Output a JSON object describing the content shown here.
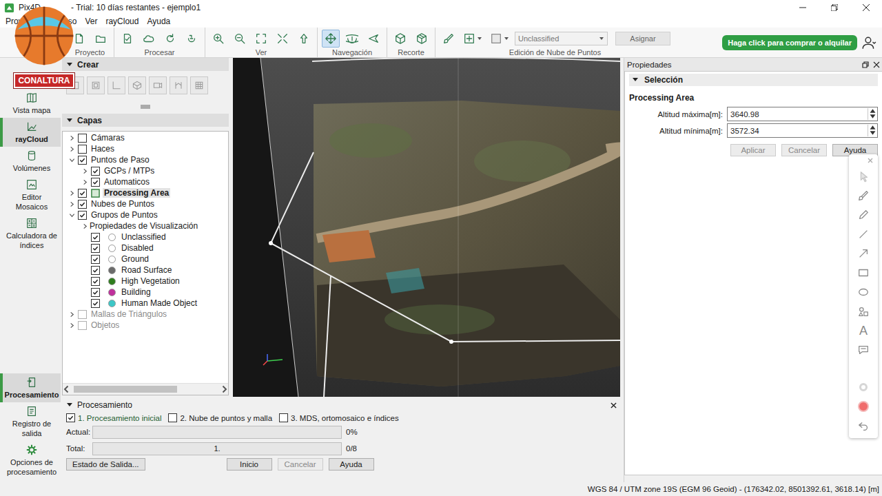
{
  "window": {
    "title_app": "Pix4D",
    "title_rest": "- Trial: 10 días restantes - ejemplo1"
  },
  "watermark": "CONALTURA",
  "menu": [
    "Proyecto",
    "Proceso",
    "Ver",
    "rayCloud",
    "Ayuda"
  ],
  "toolbar": {
    "groups": [
      {
        "label": "Proyecto",
        "tools": [
          {
            "selected": false
          },
          {
            "selected": false
          }
        ]
      },
      {
        "label": "Procesar",
        "tools": [
          {
            "selected": false
          },
          {
            "selected": false
          },
          {
            "selected": false
          },
          {
            "selected": false
          }
        ]
      },
      {
        "label": "Ver",
        "tools": [
          {
            "selected": false
          },
          {
            "selected": false
          },
          {
            "selected": false
          },
          {
            "selected": false
          },
          {
            "selected": false
          }
        ]
      },
      {
        "label": "Navegación",
        "tools": [
          {
            "selected": true
          },
          {
            "selected": false
          },
          {
            "selected": false
          }
        ]
      },
      {
        "label": "Recorte",
        "tools": [
          {
            "selected": false
          },
          {
            "selected": false
          }
        ]
      }
    ],
    "edit": {
      "label": "Edición de Nube de Puntos",
      "class_select": "Unclassified",
      "assign": "Asignar"
    },
    "buy": "Haga click para comprar o alquilar"
  },
  "sidebar": {
    "top": [
      {
        "label": "Vista mapa",
        "selected": false
      },
      {
        "label": "rayCloud",
        "selected": true
      },
      {
        "label": "Volúmenes",
        "selected": false
      },
      {
        "label": "Editor Mosaicos",
        "selected": false
      },
      {
        "label": "Calculadora de índices",
        "selected": false
      }
    ],
    "bottom": [
      {
        "label": "Procesamiento",
        "selected": true
      },
      {
        "label": "Registro de salida",
        "selected": false
      },
      {
        "label": "Opciones de procesamiento",
        "selected": false
      }
    ]
  },
  "create": {
    "title": "Crear"
  },
  "layers": {
    "title": "Capas",
    "items": [
      {
        "label": "Cámaras",
        "kind": "layer",
        "depth": 0,
        "expandable": true,
        "expanded": false,
        "checked": false,
        "selected": false,
        "disabled": false,
        "color": ""
      },
      {
        "label": "Haces",
        "kind": "layer",
        "depth": 0,
        "expandable": true,
        "expanded": false,
        "checked": false,
        "selected": false,
        "disabled": false,
        "color": ""
      },
      {
        "label": "Puntos de Paso",
        "kind": "layer",
        "depth": 0,
        "expandable": true,
        "expanded": true,
        "checked": true,
        "selected": false,
        "disabled": false,
        "color": ""
      },
      {
        "label": "GCPs / MTPs",
        "kind": "layer",
        "depth": 1,
        "expandable": true,
        "expanded": false,
        "checked": true,
        "selected": false,
        "disabled": false,
        "color": ""
      },
      {
        "label": "Automaticos",
        "kind": "layer",
        "depth": 1,
        "expandable": true,
        "expanded": false,
        "checked": true,
        "selected": false,
        "disabled": false,
        "color": ""
      },
      {
        "label": "Processing Area",
        "kind": "area",
        "depth": 0,
        "expandable": true,
        "expanded": false,
        "checked": true,
        "selected": true,
        "disabled": false,
        "color": ""
      },
      {
        "label": "Nubes de Puntos",
        "kind": "layer",
        "depth": 0,
        "expandable": true,
        "expanded": false,
        "checked": true,
        "selected": false,
        "disabled": false,
        "color": ""
      },
      {
        "label": "Grupos de Puntos",
        "kind": "layer",
        "depth": 0,
        "expandable": true,
        "expanded": true,
        "checked": true,
        "selected": false,
        "disabled": false,
        "color": ""
      },
      {
        "label": "Propiedades de Visualización",
        "kind": "folder",
        "depth": 1,
        "expandable": true,
        "expanded": false,
        "checked": false,
        "selected": false,
        "disabled": false,
        "color": ""
      },
      {
        "label": "Unclassified",
        "kind": "class",
        "depth": 1,
        "expandable": false,
        "expanded": false,
        "checked": true,
        "selected": false,
        "disabled": false,
        "color": "#ffffff"
      },
      {
        "label": "Disabled",
        "kind": "class",
        "depth": 1,
        "expandable": false,
        "expanded": false,
        "checked": true,
        "selected": false,
        "disabled": false,
        "color": "#ffffff"
      },
      {
        "label": "Ground",
        "kind": "class",
        "depth": 1,
        "expandable": false,
        "expanded": false,
        "checked": true,
        "selected": false,
        "disabled": false,
        "color": "#ffffff"
      },
      {
        "label": "Road Surface",
        "kind": "class",
        "depth": 1,
        "expandable": false,
        "expanded": false,
        "checked": true,
        "selected": false,
        "disabled": false,
        "color": "#6b6b6b"
      },
      {
        "label": "High Vegetation",
        "kind": "class",
        "depth": 1,
        "expandable": false,
        "expanded": false,
        "checked": true,
        "selected": false,
        "disabled": false,
        "color": "#2f7d1e"
      },
      {
        "label": "Building",
        "kind": "class",
        "depth": 1,
        "expandable": false,
        "expanded": false,
        "checked": true,
        "selected": false,
        "disabled": false,
        "color": "#c0309c"
      },
      {
        "label": "Human Made Object",
        "kind": "class",
        "depth": 1,
        "expandable": false,
        "expanded": false,
        "checked": true,
        "selected": false,
        "disabled": false,
        "color": "#3cc7c7"
      },
      {
        "label": "Mallas de Triángulos",
        "kind": "layer",
        "depth": 0,
        "expandable": true,
        "expanded": false,
        "checked": false,
        "selected": false,
        "disabled": true,
        "color": ""
      },
      {
        "label": "Objetos",
        "kind": "layer",
        "depth": 0,
        "expandable": true,
        "expanded": false,
        "checked": false,
        "selected": false,
        "disabled": true,
        "color": ""
      }
    ]
  },
  "properties": {
    "title": "Propiedades",
    "section": "Selección",
    "object": "Processing Area",
    "fields": [
      {
        "label": "Altitud máxima[m]:",
        "value": "3640.98"
      },
      {
        "label": "Altitud mínima[m]:",
        "value": "3572.34"
      }
    ],
    "buttons": [
      {
        "label": "Aplicar",
        "disabled": true
      },
      {
        "label": "Cancelar",
        "disabled": true
      },
      {
        "label": "Ayuda",
        "disabled": false
      }
    ]
  },
  "annotation_toolbar": {
    "text_tool": "A"
  },
  "processing": {
    "title": "Procesamiento",
    "steps": [
      {
        "label": "1. Procesamiento inicial",
        "checked": true
      },
      {
        "label": "2. Nube de puntos y malla",
        "checked": false
      },
      {
        "label": "3. MDS, ortomosaico e índices",
        "checked": false
      }
    ],
    "progress": [
      {
        "label": "Actual:",
        "level": 0,
        "inner": "",
        "reading": "0%"
      },
      {
        "label": "Total:",
        "level": 0,
        "inner": "1.",
        "reading": "0/8"
      }
    ],
    "status_button": {
      "label": "Estado de Salida...",
      "disabled": false
    },
    "buttons": [
      {
        "label": "Inicio",
        "disabled": false
      },
      {
        "label": "Cancelar",
        "disabled": true
      },
      {
        "label": "Ayuda",
        "disabled": false
      }
    ]
  },
  "status_bar": "WGS 84 / UTM zone 19S (EGM 96 Geoid) - (176342.02, 8501392.61, 3618.14) [m]"
}
